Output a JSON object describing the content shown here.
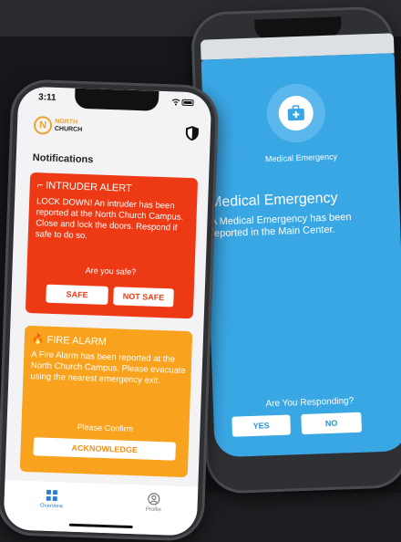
{
  "colors": {
    "alert_red": "#ee3a14",
    "fire_orange": "#f8a21d",
    "medical_blue": "#3aa7e5",
    "brand": "#f2a22a",
    "tab_active": "#2a7fd4"
  },
  "left_phone": {
    "status_time": "3:11",
    "logo": {
      "letter": "N",
      "line1": "NORTH",
      "line2": "CHURCH"
    },
    "header_icon": "shield-icon",
    "section_title": "Notifications",
    "intruder": {
      "icon": "gun-icon",
      "title": "INTRUDER ALERT",
      "body": "LOCK DOWN! An intruder has been reported at the North Church Campus. Close and lock the doors. Respond if safe to do so.",
      "question": "Are you safe?",
      "safe_label": "SAFE",
      "not_safe_label": "NOT SAFE"
    },
    "fire": {
      "icon": "fire-icon",
      "title": "FIRE ALARM",
      "body": "A Fire Alarm has been reported at the North Church Campus. Please evacuate using the nearest emergency exit.",
      "question": "Please Confirm",
      "ack_label": "ACKNOWLEDGE"
    },
    "tabs": [
      {
        "label": "Overview",
        "icon": "grid-icon"
      },
      {
        "label": "Profile",
        "icon": "user-icon"
      }
    ]
  },
  "right_phone": {
    "icon": "first-aid-icon",
    "small_label": "Medical Emergency",
    "title": "Medical Emergency",
    "description": "A Medical Emergency has been reported in the Main Center.",
    "question": "Are You Responding?",
    "yes_label": "YES",
    "no_label": "NO"
  }
}
